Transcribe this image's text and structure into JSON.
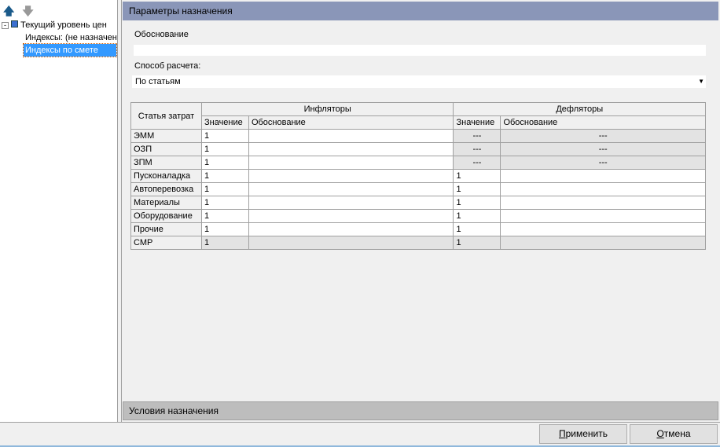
{
  "toolbar": {
    "up_icon": "arrow-up-icon",
    "down_icon": "arrow-down-icon"
  },
  "tree": {
    "root": "Текущий уровень цен",
    "items": [
      "Индексы: (не назначен",
      "Индексы по смете"
    ]
  },
  "panel": {
    "title": "Параметры назначения",
    "reason_label": "Обоснование",
    "reason_value": "",
    "method_label": "Способ расчета:",
    "method_value": "По статьям",
    "table": {
      "col_item": "Статья затрат",
      "group_inf": "Инфляторы",
      "group_def": "Дефляторы",
      "sub_value": "Значение",
      "sub_reason": "Обоснование",
      "rows": [
        {
          "name": "ЭММ",
          "inf": "1",
          "inf_reason": "",
          "def": "---",
          "def_reason": "---"
        },
        {
          "name": "ОЗП",
          "inf": "1",
          "inf_reason": "",
          "def": "---",
          "def_reason": "---"
        },
        {
          "name": "ЗПМ",
          "inf": "1",
          "inf_reason": "",
          "def": "---",
          "def_reason": "---"
        },
        {
          "name": "Пусконаладка",
          "inf": "1",
          "inf_reason": "",
          "def": "1",
          "def_reason": ""
        },
        {
          "name": "Автоперевозка",
          "inf": "1",
          "inf_reason": "",
          "def": "1",
          "def_reason": ""
        },
        {
          "name": "Материалы",
          "inf": "1",
          "inf_reason": "",
          "def": "1",
          "def_reason": ""
        },
        {
          "name": "Оборудование",
          "inf": "1",
          "inf_reason": "",
          "def": "1",
          "def_reason": ""
        },
        {
          "name": "Прочие",
          "inf": "1",
          "inf_reason": "",
          "def": "1",
          "def_reason": ""
        },
        {
          "name": "СМР",
          "inf": "1",
          "inf_reason": "",
          "def": "1",
          "def_reason": ""
        }
      ]
    }
  },
  "conditions": {
    "title": "Условия назначения"
  },
  "buttons": {
    "apply_hot": "П",
    "apply_rest": "рименить",
    "cancel_hot": "О",
    "cancel_rest": "тмена"
  }
}
